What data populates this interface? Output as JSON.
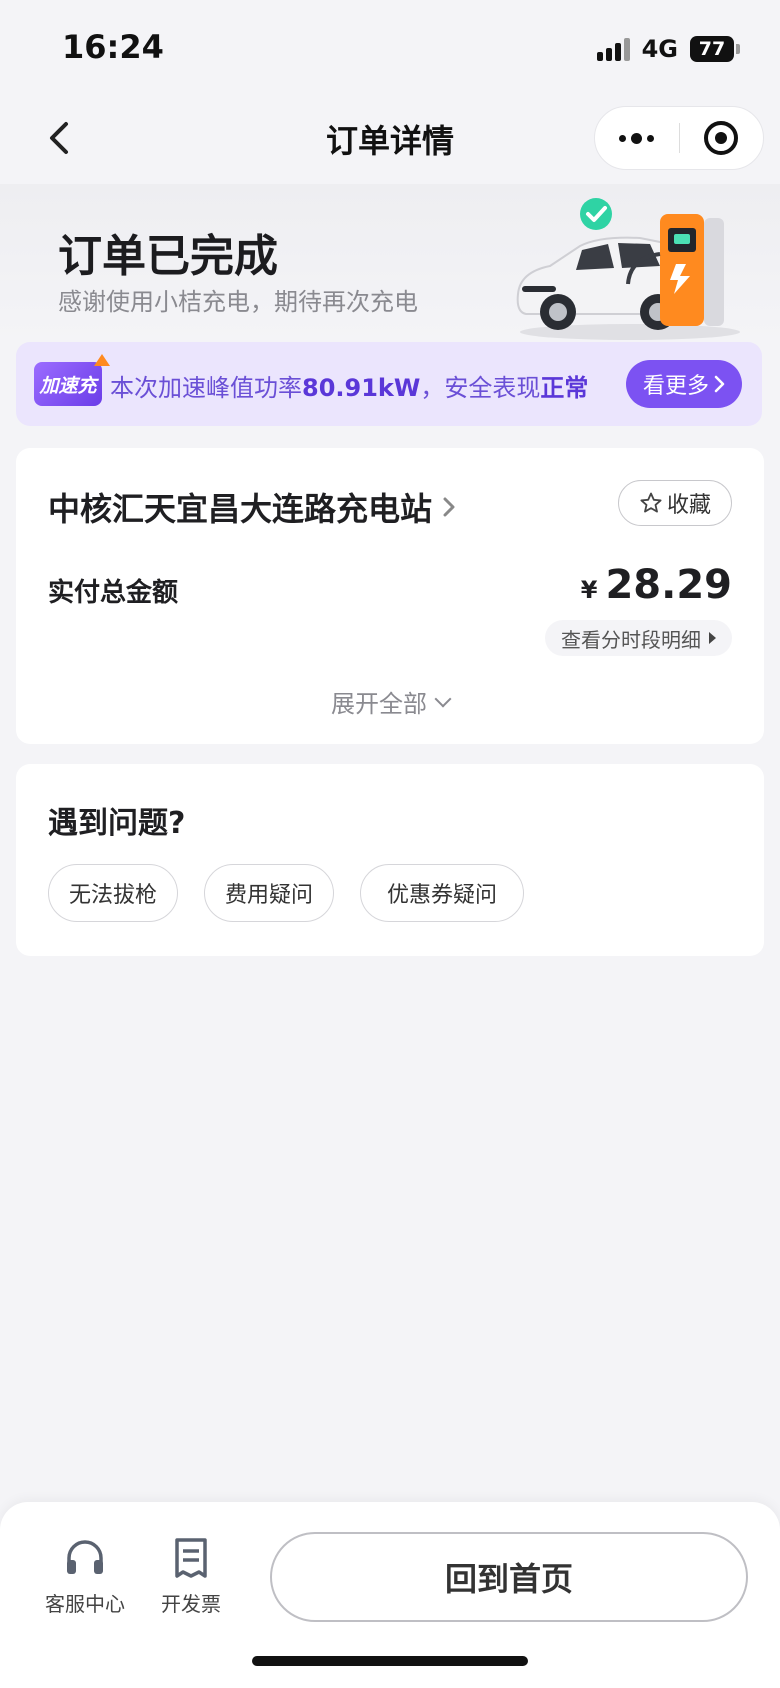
{
  "status_bar": {
    "time": "16:24",
    "network": "4G",
    "battery": "77"
  },
  "nav": {
    "title": "订单详情",
    "back_icon": "chevron-left-icon",
    "more_icon": "more-dots-icon",
    "close_icon": "target-icon"
  },
  "header": {
    "status": "订单已完成",
    "subtitle": "感谢使用小桔充电，期待再次充电"
  },
  "boost": {
    "badge": "加速充",
    "text_prefix": "本次加速峰值功率",
    "peak_power": "80.91kW",
    "text_middle": "，安全表现",
    "safety": "正常",
    "more_label": "看更多"
  },
  "station": {
    "name": "中核汇天宜昌大连路充电站",
    "favorite_label": "收藏",
    "paid_label": "实付总金额",
    "currency": "¥",
    "amount": "28.29",
    "detail_label": "查看分时段明细",
    "expand_label": "展开全部"
  },
  "problems": {
    "title": "遇到问题?",
    "items": [
      "无法拔枪",
      "费用疑问",
      "优惠券疑问"
    ]
  },
  "bottom": {
    "service_label": "客服中心",
    "invoice_label": "开发票",
    "home_label": "回到首页"
  },
  "colors": {
    "accent_purple": "#7c52f2",
    "boost_bg": "#ebe5fd",
    "charger_orange": "#ff8a1f",
    "check_green": "#2fd3a4"
  }
}
